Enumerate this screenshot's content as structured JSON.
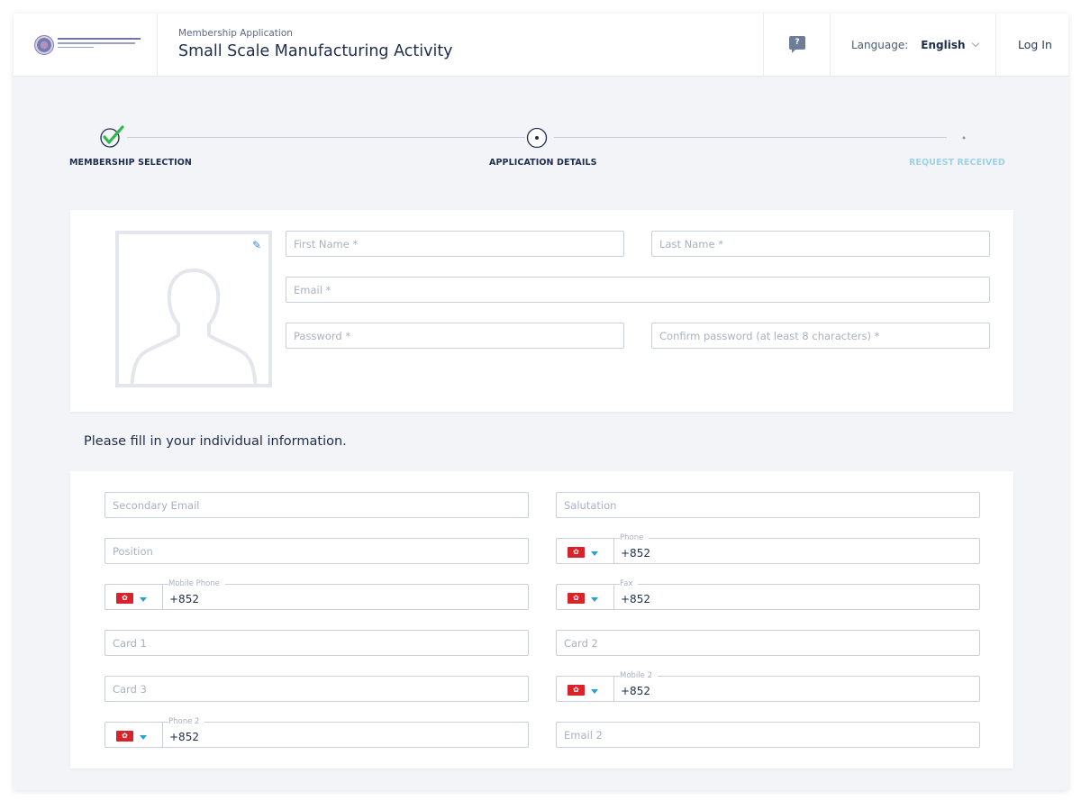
{
  "header": {
    "subtitle": "Membership Application",
    "title": "Small Scale Manufacturing Activity",
    "help_icon": "question-chat-icon",
    "language_label": "Language:",
    "language_value": "English",
    "login": "Log In"
  },
  "stepper": {
    "steps": [
      {
        "label": "MEMBERSHIP SELECTION",
        "state": "done"
      },
      {
        "label": "APPLICATION DETAILS",
        "state": "current"
      },
      {
        "label": "REQUEST RECEIVED",
        "state": "pending"
      }
    ]
  },
  "account": {
    "first_name": "First Name *",
    "last_name": "Last Name *",
    "email": "Email *",
    "password": "Password *",
    "confirm_password": "Confirm password (at least 8 characters) *"
  },
  "individual": {
    "heading": "Please fill in your individual information.",
    "secondary_email": "Secondary Email",
    "salutation": "Salutation",
    "position": "Position",
    "phone_label": "Phone",
    "mobile_label": "Mobile Phone",
    "fax_label": "Fax",
    "card1": "Card 1",
    "card2": "Card 2",
    "card3": "Card 3",
    "mobile2_label": "Mobile 2",
    "phone2_label": "Phone 2",
    "email2": "Email 2",
    "country_code": "+852"
  },
  "colors": {
    "accent": "#2a9fd8",
    "check": "#2db84b",
    "flag": "#d8232a",
    "heading": "#1e2d4c"
  }
}
